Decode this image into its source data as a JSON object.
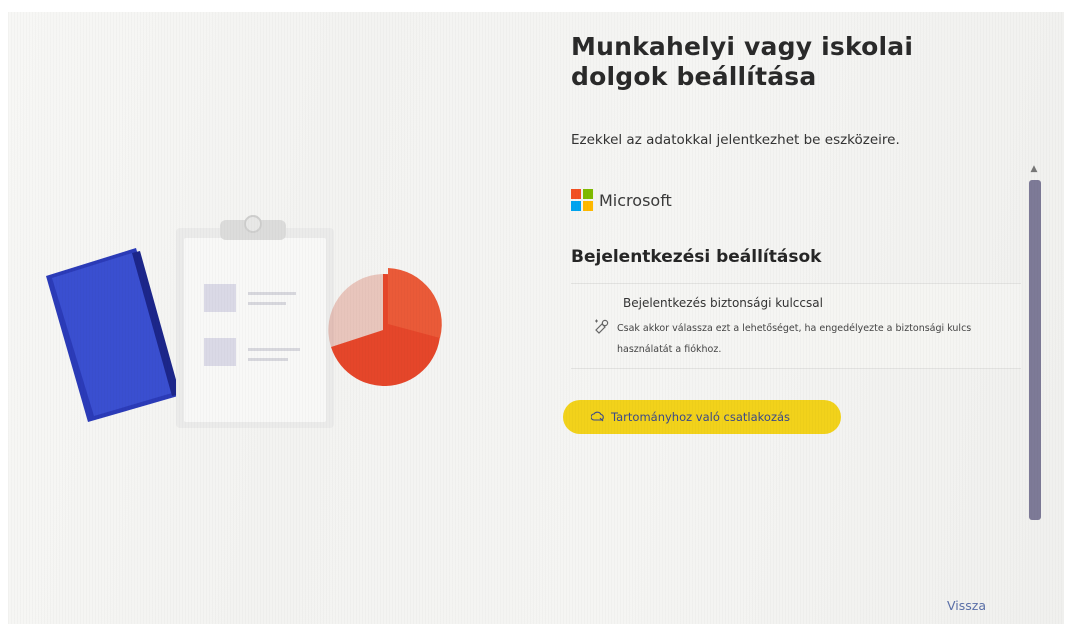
{
  "header": {
    "title": "Munkahelyi vagy iskolai dolgok beállítása",
    "subtitle": "Ezekkel az adatokkal jelentkezhet be eszközeire."
  },
  "brand": {
    "name": "Microsoft",
    "logo_colors": [
      "#f25022",
      "#7fba00",
      "#00a4ef",
      "#ffb900"
    ]
  },
  "signin": {
    "section_title": "Bejelentkezési beállítások",
    "option": {
      "title": "Bejelentkezés biztonsági kulccsal",
      "description": "Csak akkor válassza ezt a lehetőséget, ha engedélyezte a biztonsági kulcs használatát a fiókhoz.",
      "icon": "security-key-icon"
    },
    "join_domain_label": "Tartományhoz való csatlakozás",
    "join_domain_icon": "domain-join-icon",
    "join_highlight_color": "#f2d21b"
  },
  "footer": {
    "back_label": "Vissza"
  },
  "colors": {
    "notebook": "#2f3fc0",
    "pie": "#e5462a",
    "scroll_thumb": "#7d7a97"
  }
}
